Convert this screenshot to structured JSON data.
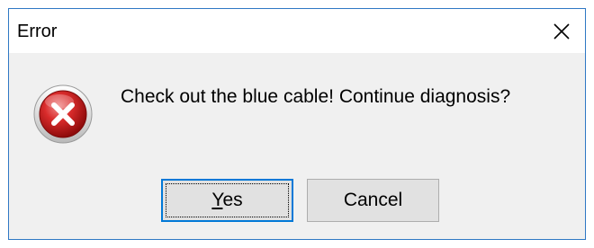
{
  "dialog": {
    "title": "Error",
    "message": "Check out the blue cable! Continue diagnosis?",
    "icon": "error-icon",
    "close_icon": "close-icon"
  },
  "buttons": {
    "yes": {
      "mnemonic": "Y",
      "rest": "es"
    },
    "cancel": {
      "label": "Cancel"
    }
  },
  "colors": {
    "window_border": "#2f78c4",
    "titlebar_bg": "#ffffff",
    "body_bg": "#f0f0f0",
    "button_bg": "#e1e1e1",
    "default_button_border": "#0078d7",
    "error_red": "#c8102e"
  }
}
